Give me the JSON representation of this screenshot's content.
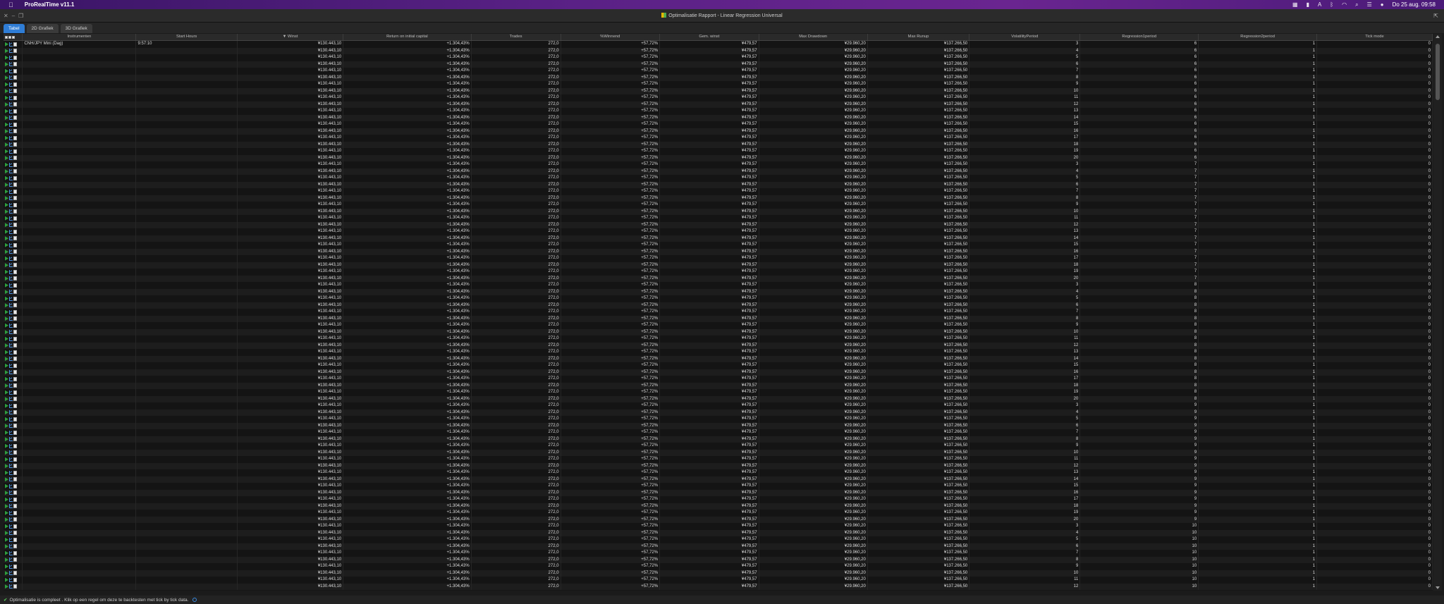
{
  "menubar": {
    "app_name": "ProRealTime v11.1",
    "datetime": "Do 25 aug.  09:58"
  },
  "window": {
    "title": "Optimalisatie Rapport - Linear Regression Universal"
  },
  "tabs": [
    "Tabel",
    "2D Grafiek",
    "3D Grafiek"
  ],
  "table": {
    "columns": [
      "Instrumenten",
      "Start Hours",
      "Winst",
      "Return on initial capital",
      "Trades",
      "%Winnend",
      "Gem. winst",
      "Max Drawdown",
      "Max Runup",
      "VolatilityPeriod",
      "Regression1period",
      "Regression2period",
      "Tick mode"
    ],
    "sort_indicator": "▼",
    "first_row": {
      "instrument": "CNH/JPY Mini (Dag)",
      "start_hours": "9:57:10"
    },
    "constants": {
      "winst": "¥130.443,10",
      "return": "+1.304,43%",
      "trades": "272,0",
      "winnend": "+57,72%",
      "gem_winst": "¥479,57",
      "max_drawdown": "¥29.960,20",
      "max_runup": "¥137.266,50",
      "regression2period": "1",
      "tick_mode": "0"
    },
    "rows": [
      [
        3,
        6
      ],
      [
        4,
        6
      ],
      [
        5,
        6
      ],
      [
        6,
        6
      ],
      [
        7,
        6
      ],
      [
        8,
        6
      ],
      [
        9,
        6
      ],
      [
        10,
        6
      ],
      [
        11,
        6
      ],
      [
        12,
        6
      ],
      [
        13,
        6
      ],
      [
        14,
        6
      ],
      [
        15,
        6
      ],
      [
        16,
        6
      ],
      [
        17,
        6
      ],
      [
        18,
        6
      ],
      [
        19,
        6
      ],
      [
        20,
        6
      ],
      [
        3,
        7
      ],
      [
        4,
        7
      ],
      [
        5,
        7
      ],
      [
        6,
        7
      ],
      [
        7,
        7
      ],
      [
        8,
        7
      ],
      [
        9,
        7
      ],
      [
        10,
        7
      ],
      [
        11,
        7
      ],
      [
        12,
        7
      ],
      [
        13,
        7
      ],
      [
        14,
        7
      ],
      [
        15,
        7
      ],
      [
        16,
        7
      ],
      [
        17,
        7
      ],
      [
        18,
        7
      ],
      [
        19,
        7
      ],
      [
        20,
        7
      ],
      [
        3,
        8
      ],
      [
        4,
        8
      ],
      [
        5,
        8
      ],
      [
        6,
        8
      ],
      [
        7,
        8
      ],
      [
        8,
        8
      ],
      [
        9,
        8
      ],
      [
        10,
        8
      ],
      [
        11,
        8
      ],
      [
        12,
        8
      ],
      [
        13,
        8
      ],
      [
        14,
        8
      ],
      [
        15,
        8
      ],
      [
        16,
        8
      ],
      [
        17,
        8
      ],
      [
        18,
        8
      ],
      [
        19,
        8
      ],
      [
        20,
        8
      ],
      [
        3,
        9
      ],
      [
        4,
        9
      ],
      [
        5,
        9
      ],
      [
        6,
        9
      ],
      [
        7,
        9
      ],
      [
        8,
        9
      ],
      [
        9,
        9
      ],
      [
        10,
        9
      ],
      [
        11,
        9
      ],
      [
        12,
        9
      ],
      [
        13,
        9
      ],
      [
        14,
        9
      ],
      [
        15,
        9
      ],
      [
        16,
        9
      ],
      [
        17,
        9
      ],
      [
        18,
        9
      ],
      [
        19,
        9
      ],
      [
        20,
        9
      ],
      [
        3,
        10
      ],
      [
        4,
        10
      ],
      [
        5,
        10
      ],
      [
        6,
        10
      ],
      [
        7,
        10
      ],
      [
        8,
        10
      ],
      [
        9,
        10
      ],
      [
        10,
        10
      ],
      [
        11,
        10
      ],
      [
        12,
        10
      ]
    ]
  },
  "statusbar": {
    "message": "Optimalisatie is compleet . Klik op een regel om deze te backtesten met tick by tick data."
  },
  "colors": {
    "active_tab": "#2f7dd6",
    "menubar": "#5a2186",
    "status_ok": "#5cd65c"
  }
}
